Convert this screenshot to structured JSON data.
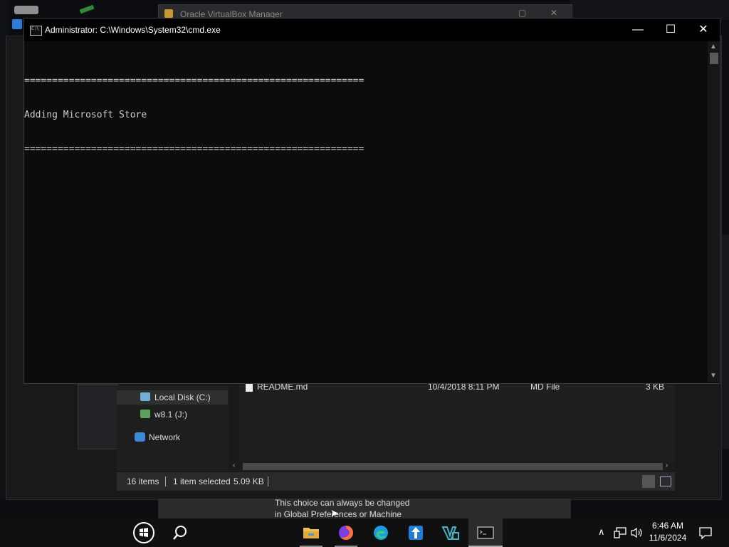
{
  "background_window": {
    "title": "Oracle VirtualBox Manager"
  },
  "explorer": {
    "nav": {
      "local_disk": "Local Disk (C:)",
      "w81": "w8.1 (J:)",
      "network": "Network"
    },
    "file": {
      "name": "README.md",
      "date": "10/4/2018 8:11 PM",
      "type": "MD File",
      "size": "3 KB"
    },
    "status": {
      "items": "16 items",
      "selected": "1 item selected",
      "size": "5.09 KB"
    }
  },
  "tooltip": {
    "line1": "This choice can always be changed",
    "line2": "in Global Preferences or Machine"
  },
  "cmd": {
    "title": "Administrator: C:\\Windows\\System32\\cmd.exe",
    "console": {
      "separator": "=============================================================",
      "message": "Adding Microsoft Store"
    }
  },
  "taskbar": {
    "time": "6:46 AM",
    "date": "11/6/2024"
  },
  "icons": {
    "start": "windows-logo-icon",
    "search": "search-icon",
    "explorer": "folder-icon",
    "firefox": "firefox-icon",
    "edge": "edge-icon",
    "virtualbox": "virtualbox-icon",
    "vscode": "visual-studio-icon",
    "terminal": "cmd-icon",
    "tray_up": "chevron-up-icon",
    "network": "network-icon",
    "volume": "volume-icon",
    "notifications": "notification-icon"
  },
  "colors": {
    "console_bg": "#0c0c0c",
    "console_text": "#cccccc",
    "taskbar": "#101010",
    "accent_blue": "#2b7bd8"
  }
}
